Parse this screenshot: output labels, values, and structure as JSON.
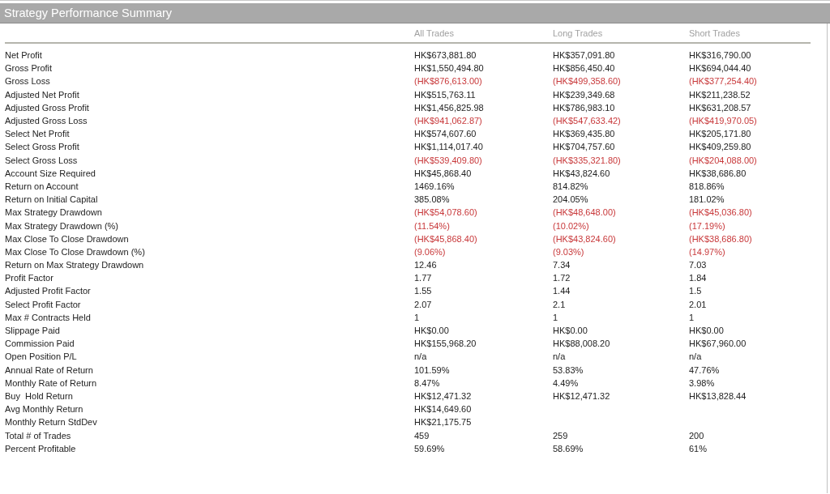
{
  "title": "Strategy Performance Summary",
  "columns": [
    "All Trades",
    "Long Trades",
    "Short Trades"
  ],
  "rows": [
    {
      "label": "Net Profit",
      "negative": false,
      "values": [
        "HK$673,881.80",
        "HK$357,091.80",
        "HK$316,790.00"
      ]
    },
    {
      "label": "Gross Profit",
      "negative": false,
      "values": [
        "HK$1,550,494.80",
        "HK$856,450.40",
        "HK$694,044.40"
      ]
    },
    {
      "label": "Gross Loss",
      "negative": true,
      "values": [
        "(HK$876,613.00)",
        "(HK$499,358.60)",
        "(HK$377,254.40)"
      ]
    },
    {
      "label": "Adjusted Net Profit",
      "negative": false,
      "values": [
        "HK$515,763.11",
        "HK$239,349.68",
        "HK$211,238.52"
      ]
    },
    {
      "label": "Adjusted Gross Profit",
      "negative": false,
      "values": [
        "HK$1,456,825.98",
        "HK$786,983.10",
        "HK$631,208.57"
      ]
    },
    {
      "label": "Adjusted Gross Loss",
      "negative": true,
      "values": [
        "(HK$941,062.87)",
        "(HK$547,633.42)",
        "(HK$419,970.05)"
      ]
    },
    {
      "label": "Select Net Profit",
      "negative": false,
      "values": [
        "HK$574,607.60",
        "HK$369,435.80",
        "HK$205,171.80"
      ]
    },
    {
      "label": "Select Gross Profit",
      "negative": false,
      "values": [
        "HK$1,114,017.40",
        "HK$704,757.60",
        "HK$409,259.80"
      ]
    },
    {
      "label": "Select Gross Loss",
      "negative": true,
      "values": [
        "(HK$539,409.80)",
        "(HK$335,321.80)",
        "(HK$204,088.00)"
      ]
    },
    {
      "label": "Account Size Required",
      "negative": false,
      "values": [
        "HK$45,868.40",
        "HK$43,824.60",
        "HK$38,686.80"
      ]
    },
    {
      "label": "Return on Account",
      "negative": false,
      "values": [
        "1469.16%",
        "814.82%",
        "818.86%"
      ]
    },
    {
      "label": "Return on Initial Capital",
      "negative": false,
      "values": [
        "385.08%",
        "204.05%",
        "181.02%"
      ]
    },
    {
      "label": "Max Strategy Drawdown",
      "negative": true,
      "values": [
        "(HK$54,078.60)",
        "(HK$48,648.00)",
        "(HK$45,036.80)"
      ]
    },
    {
      "label": "Max Strategy Drawdown (%)",
      "negative": true,
      "values": [
        "(11.54%)",
        "(10.02%)",
        "(17.19%)"
      ]
    },
    {
      "label": "Max Close To Close Drawdown",
      "negative": true,
      "values": [
        "(HK$45,868.40)",
        "(HK$43,824.60)",
        "(HK$38,686.80)"
      ]
    },
    {
      "label": "Max Close To Close Drawdown (%)",
      "negative": true,
      "values": [
        "(9.06%)",
        "(9.03%)",
        "(14.97%)"
      ]
    },
    {
      "label": "Return on Max Strategy Drawdown",
      "negative": false,
      "values": [
        "12.46",
        "7.34",
        "7.03"
      ]
    },
    {
      "label": "Profit Factor",
      "negative": false,
      "values": [
        "1.77",
        "1.72",
        "1.84"
      ]
    },
    {
      "label": "Adjusted Profit Factor",
      "negative": false,
      "values": [
        "1.55",
        "1.44",
        "1.5"
      ]
    },
    {
      "label": "Select Profit Factor",
      "negative": false,
      "values": [
        "2.07",
        "2.1",
        "2.01"
      ]
    },
    {
      "label": "Max # Contracts Held",
      "negative": false,
      "values": [
        "1",
        "1",
        "1"
      ]
    },
    {
      "label": "Slippage Paid",
      "negative": false,
      "values": [
        "HK$0.00",
        "HK$0.00",
        "HK$0.00"
      ]
    },
    {
      "label": "Commission Paid",
      "negative": false,
      "values": [
        "HK$155,968.20",
        "HK$88,008.20",
        "HK$67,960.00"
      ]
    },
    {
      "label": "Open Position P/L",
      "negative": false,
      "values": [
        "n/a",
        "n/a",
        "n/a"
      ]
    },
    {
      "label": "Annual Rate of Return",
      "negative": false,
      "values": [
        "101.59%",
        "53.83%",
        "47.76%"
      ]
    },
    {
      "label": "Monthly Rate of Return",
      "negative": false,
      "values": [
        "8.47%",
        "4.49%",
        "3.98%"
      ]
    },
    {
      "label": "Buy  Hold Return",
      "negative": false,
      "values": [
        "HK$12,471.32",
        "HK$12,471.32",
        "HK$13,828.44"
      ]
    },
    {
      "label": "Avg Monthly Return",
      "negative": false,
      "values": [
        "HK$14,649.60"
      ]
    },
    {
      "label": "Monthly Return StdDev",
      "negative": false,
      "values": [
        "HK$21,175.75"
      ]
    },
    {
      "label": "Total # of Trades",
      "negative": false,
      "values": [
        "459",
        "259",
        "200"
      ]
    },
    {
      "label": "Percent Profitable",
      "negative": false,
      "values": [
        "59.69%",
        "58.69%",
        "61%"
      ]
    }
  ]
}
